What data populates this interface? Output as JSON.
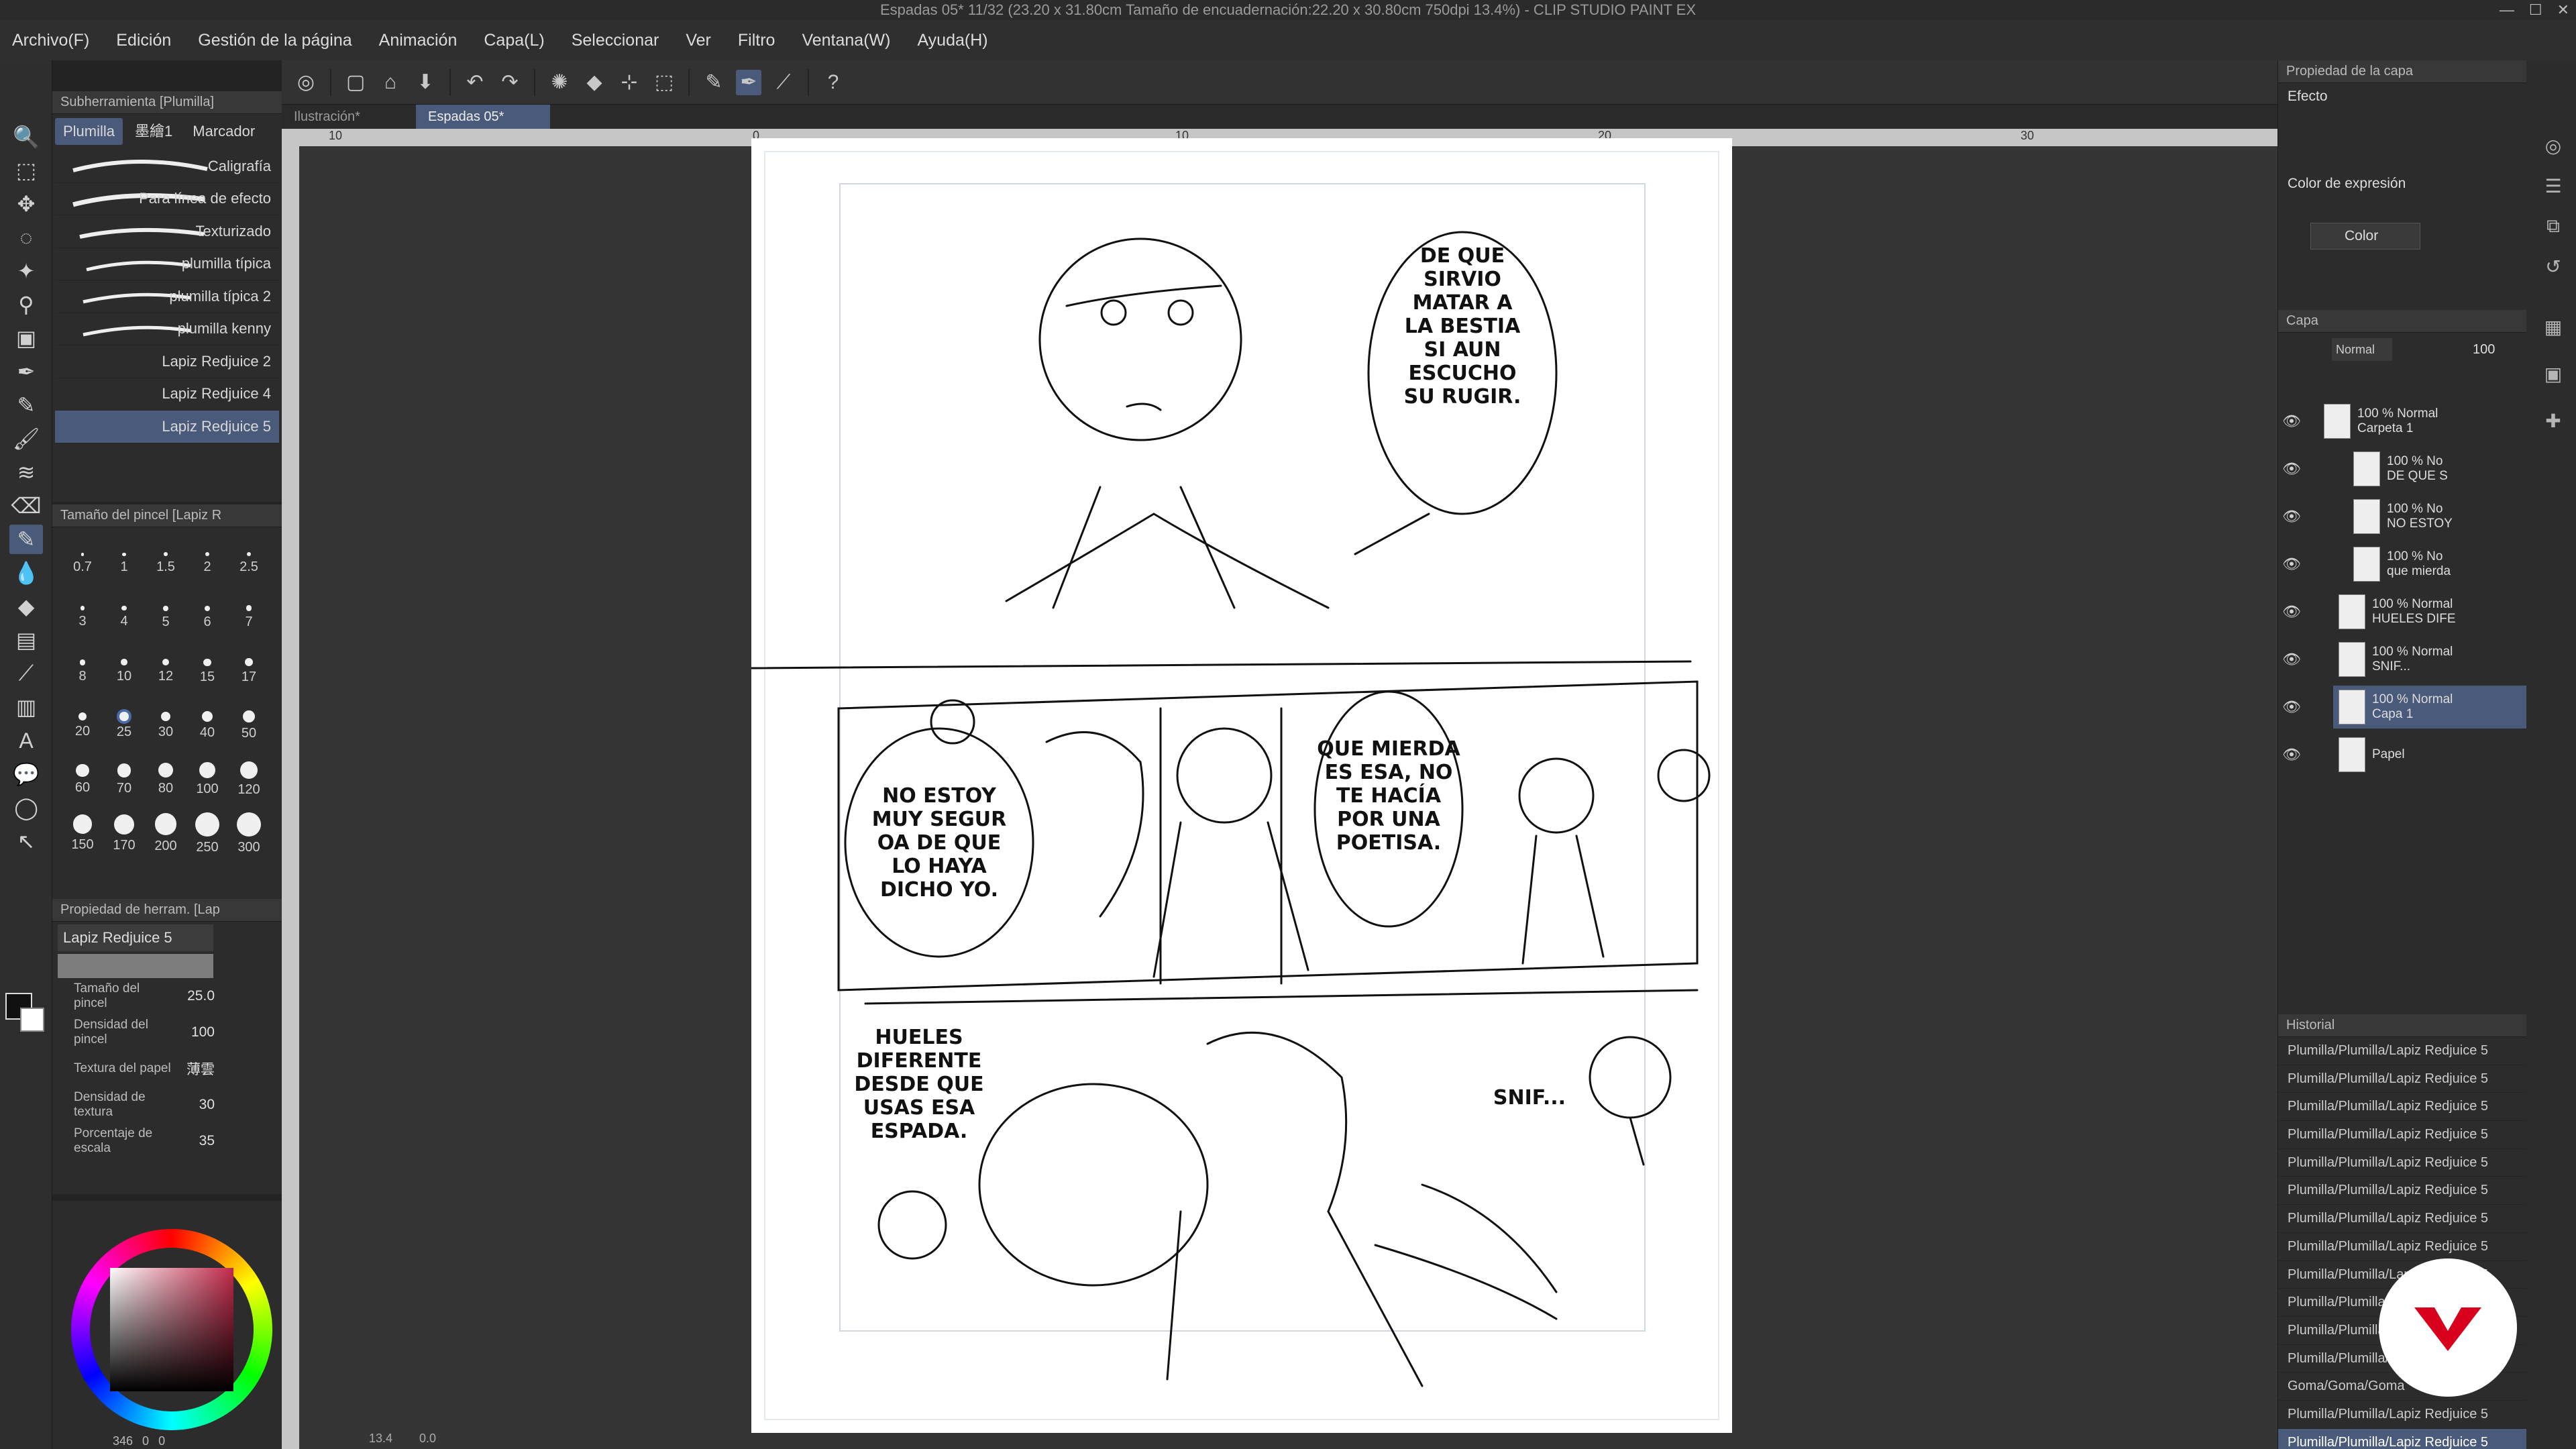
{
  "window": {
    "title": "Espadas 05* 11/32 (23.20 x 31.80cm Tamaño de encuadernación:22.20 x 30.80cm 750dpi 13.4%)  - CLIP STUDIO PAINT EX"
  },
  "menubar": [
    "Archivo(F)",
    "Edición",
    "Gestión de la página",
    "Animación",
    "Capa(L)",
    "Seleccionar",
    "Ver",
    "Filtro",
    "Ventana(W)",
    "Ayuda(H)"
  ],
  "doc_tabs": [
    {
      "label": "Ilustración*",
      "active": false
    },
    {
      "label": "Espadas 05* 11/32",
      "active": true
    }
  ],
  "ruler_marks": [
    "10",
    "0",
    "10",
    "20",
    "30"
  ],
  "subtool": {
    "panel_title": "Subherramienta [Plumilla]",
    "tabs": [
      "Plumilla",
      "墨繪1",
      "Marcador"
    ],
    "brushes": [
      "Caligrafía",
      "Para línea de efecto",
      "Texturizado",
      "plumilla típica",
      "plumilla típica 2",
      "plumilla kenny",
      "Lapiz Redjuice 2",
      "Lapiz Redjuice 4",
      "Lapiz Redjuice 5"
    ],
    "selected": "Lapiz Redjuice 5"
  },
  "brush_size": {
    "panel_title": "Tamaño del pincel [Lapiz R",
    "sizes": [
      "0.7",
      "1",
      "1.5",
      "2",
      "2.5",
      "3",
      "4",
      "5",
      "6",
      "7",
      "8",
      "10",
      "12",
      "15",
      "17",
      "20",
      "25",
      "30",
      "40",
      "50",
      "60",
      "70",
      "80",
      "100",
      "120",
      "150",
      "170",
      "200",
      "250",
      "300"
    ],
    "selected": "25"
  },
  "tool_property": {
    "panel_title": "Propiedad de herram. [Lap",
    "preset": "Lapiz Redjuice 5",
    "rows": [
      {
        "label": "Tamaño del pincel",
        "value": "25.0"
      },
      {
        "label": "Densidad del pincel",
        "value": "100"
      },
      {
        "label": "Textura del papel",
        "value": "薄雲"
      },
      {
        "label": "Densidad de textura",
        "value": "30"
      },
      {
        "label": "Porcentaje de escala",
        "value": "35"
      }
    ]
  },
  "status": {
    "zoom": "13.4",
    "angle": "0.0"
  },
  "color_readout": {
    "h": "346",
    "s": "0",
    "v": "0"
  },
  "layer_property": {
    "panel_title": "Propiedad de la capa",
    "effect_label": "Efecto",
    "expression_label": "Color de expresión",
    "expression_value": "Color"
  },
  "layer_panel": {
    "panel_title": "Capa",
    "blend_mode": "Normal",
    "opacity": "100",
    "layers": [
      {
        "name": "100 % Normal\nCarpeta 1",
        "indent": 0,
        "selected": false
      },
      {
        "name": "100 % No\nDE QUE S",
        "indent": 2,
        "selected": false
      },
      {
        "name": "100 % No\nNO ESTOY",
        "indent": 2,
        "selected": false
      },
      {
        "name": "100 % No\nque mierda",
        "indent": 2,
        "selected": false
      },
      {
        "name": "100 % Normal\nHUELES DIFE",
        "indent": 1,
        "selected": false
      },
      {
        "name": "100 % Normal\nSNIF...",
        "indent": 1,
        "selected": false
      },
      {
        "name": "100 % Normal\nCapa 1",
        "indent": 1,
        "selected": true
      },
      {
        "name": "Papel",
        "indent": 1,
        "selected": false
      }
    ]
  },
  "history": {
    "panel_title": "Historial",
    "entries": [
      "Plumilla/Plumilla/Lapiz Redjuice 5",
      "Plumilla/Plumilla/Lapiz Redjuice 5",
      "Plumilla/Plumilla/Lapiz Redjuice 5",
      "Plumilla/Plumilla/Lapiz Redjuice 5",
      "Plumilla/Plumilla/Lapiz Redjuice 5",
      "Plumilla/Plumilla/Lapiz Redjuice 5",
      "Plumilla/Plumilla/Lapiz Redjuice 5",
      "Plumilla/Plumilla/Lapiz Redjuice 5",
      "Plumilla/Plumilla/Lapiz Redjuice 5",
      "Plumilla/Plumilla/Lapiz Redjuice 5",
      "Plumilla/Plumilla/Lapiz Redjuice 5",
      "Plumilla/Plumilla/Lapiz Redjuice 5",
      "Goma/Goma/Goma",
      "Plumilla/Plumilla/Lapiz Redjuice 5",
      "Plumilla/Plumilla/Lapiz Redjuice 5"
    ]
  },
  "speech": {
    "b1": [
      "DE QUE",
      "SIRVIO",
      "MATAR A",
      "LA BESTIA",
      "SI AUN",
      "ESCUCHO",
      "SU RUGIR."
    ],
    "b2": [
      "NO ESTOY",
      "MUY SEGUR",
      "OA DE QUE",
      "LO HAYA",
      "DICHO YO."
    ],
    "b3": [
      "QUE MIERDA",
      "ES ESA, NO",
      "TE HACÍA",
      "POR UNA",
      "POETISA."
    ],
    "b4": [
      "HUELES",
      "DIFERENTE",
      "DESDE QUE",
      "USAS ESA",
      "ESPADA."
    ],
    "b5": "SNIF..."
  },
  "colors": {
    "accent": "#4a5a7a",
    "badge": "#d8001c"
  }
}
